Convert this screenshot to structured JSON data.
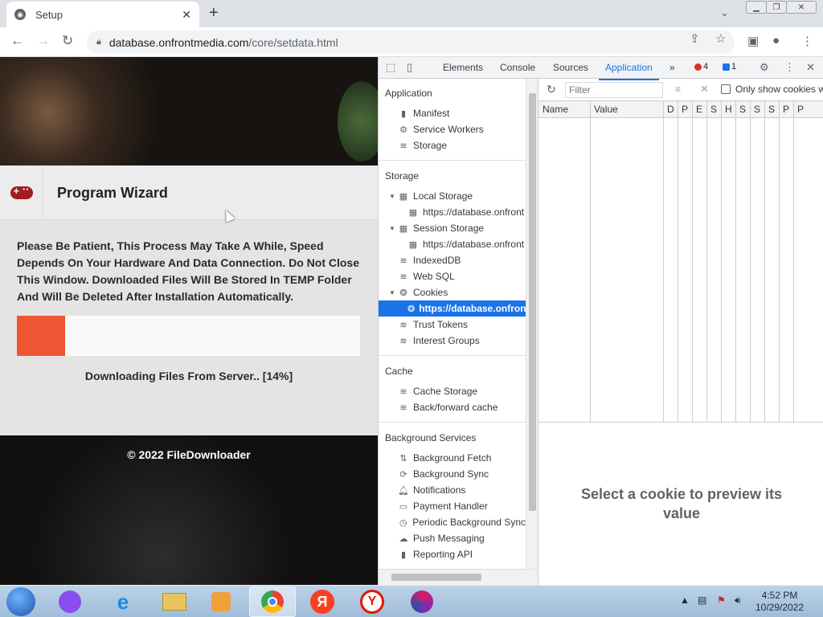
{
  "browser": {
    "tab_title": "Setup",
    "url_host": "database.onfrontmedia.com",
    "url_path": "/core/setdata.html"
  },
  "page": {
    "wizard_title": "Program Wizard",
    "message": "Please Be Patient, This Process May Take A While, Speed Depends On Your Hardware And Data Connection. Do Not Close This Window. Downloaded Files Will Be Stored In TEMP Folder And Will Be Deleted After Installation Automatically.",
    "progress_fraction": 0.14,
    "status_text": "Downloading Files From Server.. [14%]",
    "footer_text": "© 2022 FileDownloader",
    "colors": {
      "progress": "#f05533",
      "icon": "#a11d21"
    }
  },
  "devtools": {
    "tabs": [
      "Elements",
      "Console",
      "Sources",
      "Application"
    ],
    "active_tab": "Application",
    "more_tabs": "»",
    "errors_count": "4",
    "messages_count": "1",
    "sidebar": {
      "application_header": "Application",
      "application_items": [
        "Manifest",
        "Service Workers",
        "Storage"
      ],
      "storage_header": "Storage",
      "local_storage": "Local Storage",
      "local_storage_child": "https://database.onfront",
      "session_storage": "Session Storage",
      "session_storage_child": "https://database.onfront",
      "indexeddb": "IndexedDB",
      "websql": "Web SQL",
      "cookies": "Cookies",
      "cookies_child": "https://database.onfront",
      "trust_tokens": "Trust Tokens",
      "interest_groups": "Interest Groups",
      "cache_header": "Cache",
      "cache_items": [
        "Cache Storage",
        "Back/forward cache"
      ],
      "bg_header": "Background Services",
      "bg_items": [
        "Background Fetch",
        "Background Sync",
        "Notifications",
        "Payment Handler",
        "Periodic Background Sync",
        "Push Messaging",
        "Reporting API"
      ]
    },
    "cookies": {
      "filter_placeholder": "Filter",
      "only_show_label": "Only show cookies w",
      "columns": [
        "Name",
        "Value",
        "D",
        "P",
        "E",
        "S",
        "H",
        "S",
        "S",
        "S",
        "P",
        "P"
      ],
      "preview_text": "Select a cookie to preview its value"
    }
  },
  "taskbar": {
    "time": "4:52 PM",
    "date": "10/29/2022",
    "yandex_letter": "Я",
    "yandex_browser_letter": "Y"
  }
}
